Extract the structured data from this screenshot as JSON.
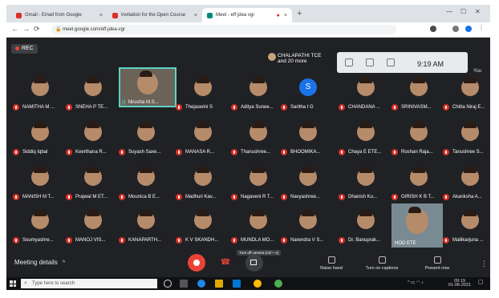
{
  "browser": {
    "tabs": [
      {
        "title": "Gmail - Email from Google",
        "color": "#d93025"
      },
      {
        "title": "Invitation for the Open Course",
        "color": "#d93025"
      },
      {
        "title": "Meet - eff jdea vgr",
        "color": "#00897b"
      }
    ],
    "url": "meet.google.com/eff-jdea-vgr"
  },
  "meet": {
    "recording_label": "REC",
    "presenter_name": "CHALAPATHI TCE",
    "presenter_more": "and 20 more",
    "time": "9:19 AM",
    "you_label": "You",
    "participants": [
      {
        "name": "NAMITHA M ..."
      },
      {
        "name": "SNEHA P TE..."
      },
      {
        "name": "Nirusha M.S...",
        "video": true,
        "speaking": true
      },
      {
        "name": "Thejaswini S"
      },
      {
        "name": "Aditya Sunee..."
      },
      {
        "name": "Saritha I G",
        "initial": "S"
      },
      {
        "name": "CHANDANA ..."
      },
      {
        "name": "SRINIVASM..."
      },
      {
        "name": "Chitta Niraj E..."
      },
      {
        "name": "Siddiq Iqbal"
      },
      {
        "name": "Keerthana R..."
      },
      {
        "name": "Suyash Saxe..."
      },
      {
        "name": "MANASA R..."
      },
      {
        "name": "Thanushree..."
      },
      {
        "name": "BHOOMIKA..."
      },
      {
        "name": "Chaya E ETE..."
      },
      {
        "name": "Roshan Raja..."
      },
      {
        "name": "Tanushree S..."
      },
      {
        "name": "MANISH M T..."
      },
      {
        "name": "Prajwal M ET..."
      },
      {
        "name": "Mounica B E..."
      },
      {
        "name": "Madhuri Kav..."
      },
      {
        "name": "Nagaveni R T..."
      },
      {
        "name": "Navyashree..."
      },
      {
        "name": "Dhanish Ku..."
      },
      {
        "name": "GIRISH K B T..."
      },
      {
        "name": "Akanksha A..."
      },
      {
        "name": "Soumyashre..."
      },
      {
        "name": "MANOJ VIS..."
      },
      {
        "name": "KANAPARTH..."
      },
      {
        "name": "K V SKANDH..."
      },
      {
        "name": "MUNDLA MO..."
      },
      {
        "name": "Narendra V S..."
      },
      {
        "name": "Dr. Banuprak..."
      },
      {
        "name": "HOD ETE",
        "video": true
      },
      {
        "name": "Mallikarjuna ..."
      }
    ],
    "controls": {
      "meeting_details": "Meeting details",
      "camera_tooltip": "Turn off camera (ctrl + e)",
      "raise_hand": "Raise hand",
      "captions": "Turn on captions",
      "present": "Present now"
    }
  },
  "taskbar": {
    "search_placeholder": "Type here to search",
    "tray_time": "09:19",
    "tray_date": "01-06-2021"
  },
  "colors": {
    "meet_bg": "#202124",
    "mic_off": "#d93025",
    "speaking": "#5cd3c4"
  }
}
